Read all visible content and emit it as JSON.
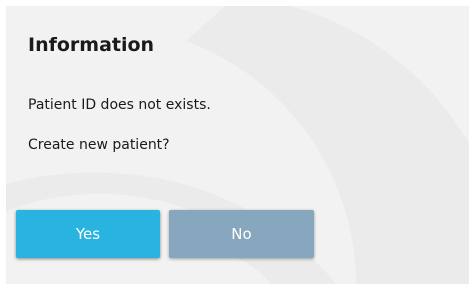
{
  "dialog": {
    "title": "Information",
    "messages": [
      "Patient ID does not exists.",
      "Create new patient?"
    ],
    "buttons": {
      "yes_label": "Yes",
      "no_label": "No"
    }
  },
  "colors": {
    "background": "#f2f2f2",
    "yes_button": "#29b3e0",
    "no_button": "#86a7bd",
    "text": "#1a1a1a"
  }
}
